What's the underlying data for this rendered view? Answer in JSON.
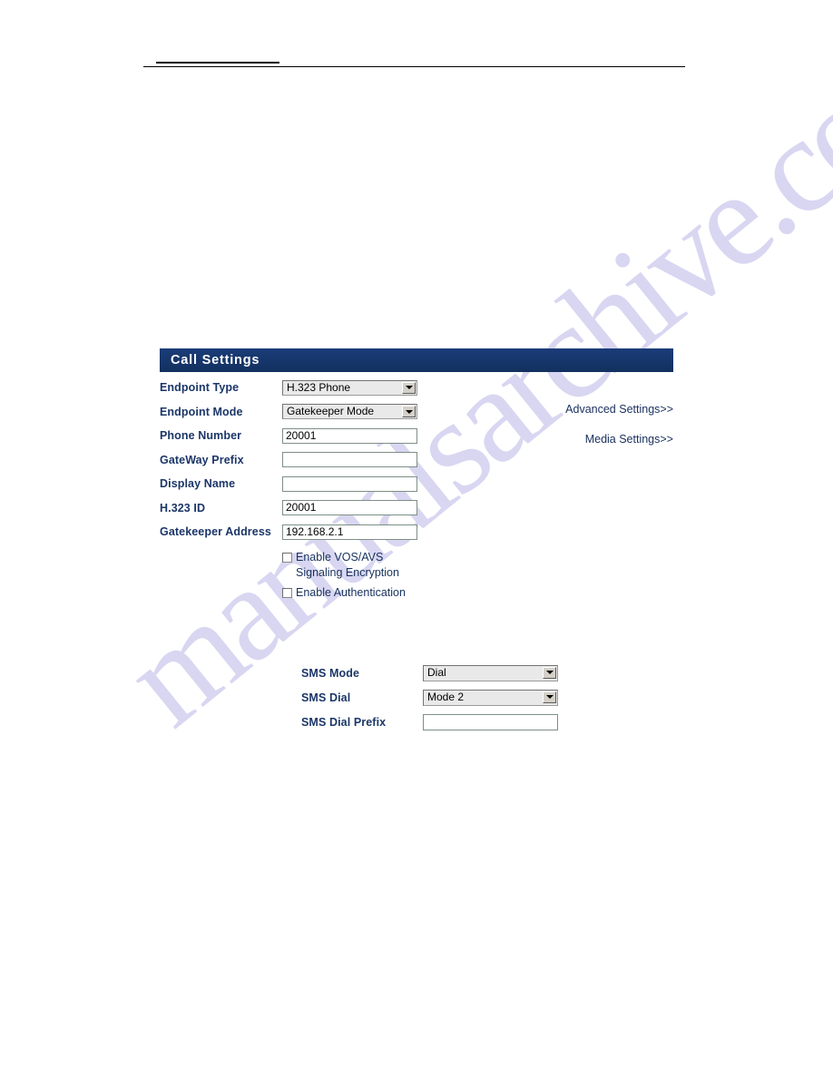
{
  "watermark": {
    "text": "manualsarchive.com"
  },
  "panel": {
    "title": "Call Settings",
    "rows": [
      {
        "label": "Endpoint Type",
        "control": "select",
        "value": "H.323 Phone"
      },
      {
        "label": "Endpoint Mode",
        "control": "select",
        "value": "Gatekeeper Mode"
      },
      {
        "label": "Phone Number",
        "control": "text",
        "value": "20001"
      },
      {
        "label": "GateWay Prefix",
        "control": "text",
        "value": ""
      },
      {
        "label": "Display Name",
        "control": "text",
        "value": ""
      },
      {
        "label": "H.323 ID",
        "control": "text",
        "value": "20001"
      },
      {
        "label": "Gatekeeper Address",
        "control": "text",
        "value": "192.168.2.1"
      }
    ],
    "checkboxes": [
      {
        "label": "Enable VOS/AVS Signaling Encryption",
        "checked": false
      },
      {
        "label": "Enable Authentication",
        "checked": false
      }
    ],
    "links": [
      {
        "label": "Advanced Settings>>"
      },
      {
        "label": "Media Settings>>"
      }
    ]
  },
  "sms": {
    "rows": [
      {
        "label": "SMS Mode",
        "control": "select",
        "value": "Dial"
      },
      {
        "label": "SMS Dial",
        "control": "select",
        "value": "Mode 2"
      },
      {
        "label": "SMS Dial Prefix",
        "control": "text",
        "value": ""
      }
    ]
  },
  "colors": {
    "header_bar": "#16336b",
    "label_text": "#1b3668",
    "input_border": "#7e8f86",
    "watermark": "#b9b6e6"
  }
}
